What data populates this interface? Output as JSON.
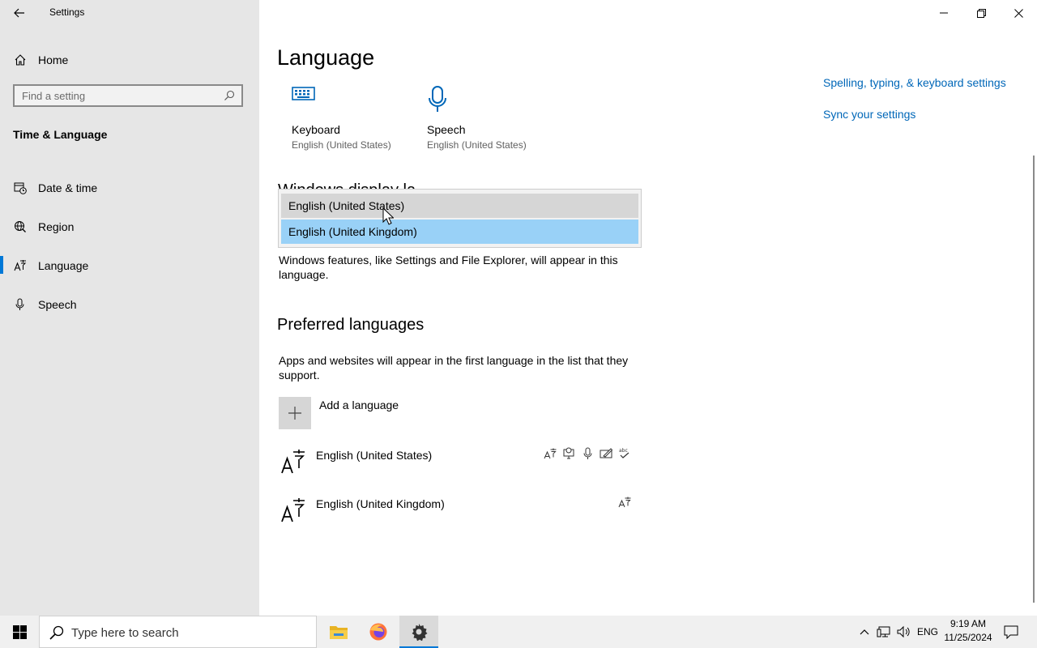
{
  "window": {
    "title": "Settings"
  },
  "sidebar": {
    "home_label": "Home",
    "search_placeholder": "Find a setting",
    "section_title": "Time & Language",
    "items": [
      {
        "label": "Date & time",
        "icon": "clock-calendar-icon"
      },
      {
        "label": "Region",
        "icon": "globe-icon"
      },
      {
        "label": "Language",
        "icon": "language-icon",
        "active": true
      },
      {
        "label": "Speech",
        "icon": "microphone-icon"
      }
    ]
  },
  "main": {
    "page_title": "Language",
    "quick_tiles": [
      {
        "name": "Keyboard",
        "sub": "English (United States)",
        "icon": "keyboard-icon"
      },
      {
        "name": "Speech",
        "sub": "English (United States)",
        "icon": "microphone-icon"
      }
    ],
    "display_language": {
      "heading_partial": "Windows display la",
      "options": [
        "English (United States)",
        "English (United Kingdom)"
      ],
      "selected": "English (United Kingdom)",
      "description": "Windows features, like Settings and File Explorer, will appear in this language."
    },
    "preferred": {
      "heading": "Preferred languages",
      "description": "Apps and websites will appear in the first language in the list that they support.",
      "add_label": "Add a language",
      "languages": [
        {
          "name": "English (United States)",
          "features": [
            "display-language-icon",
            "text-to-speech-icon",
            "speech-recognition-icon",
            "handwriting-icon",
            "spell-check-icon"
          ]
        },
        {
          "name": "English (United Kingdom)",
          "features": [
            "display-language-icon"
          ]
        }
      ]
    }
  },
  "related": {
    "links": [
      "Spelling, typing, & keyboard settings",
      "Sync your settings"
    ]
  },
  "taskbar": {
    "search_placeholder": "Type here to search",
    "apps": [
      "file-explorer-icon",
      "firefox-icon",
      "settings-icon"
    ],
    "language_indicator": "ENG",
    "time": "9:19 AM",
    "date": "11/25/2024"
  }
}
